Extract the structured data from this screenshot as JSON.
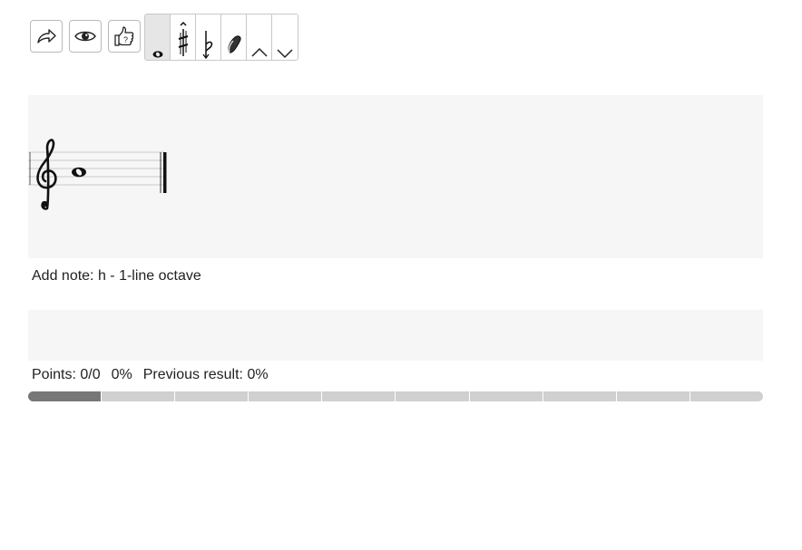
{
  "toolbar": {
    "buttons": [
      {
        "name": "share",
        "icon": "share-arrow-icon"
      },
      {
        "name": "show",
        "icon": "eye-icon"
      },
      {
        "name": "check",
        "icon": "thumbs-up-question-icon"
      }
    ],
    "note_tools": [
      {
        "name": "whole-note",
        "icon": "whole-note-icon",
        "active": true
      },
      {
        "name": "sharp",
        "icon": "sharp-icon"
      },
      {
        "name": "flat",
        "icon": "flat-icon"
      },
      {
        "name": "eraser",
        "icon": "eraser-icon"
      },
      {
        "name": "up",
        "icon": "chevron-up-icon"
      },
      {
        "name": "down",
        "icon": "chevron-down-icon"
      }
    ]
  },
  "staff": {
    "clef": "treble",
    "notes": [
      {
        "pitch": "h",
        "octave": "1-line",
        "duration": "whole"
      }
    ]
  },
  "status_text": "Add note: h - 1-line octave",
  "score": {
    "points": "Points: 0/0",
    "percent": "0%",
    "previous": "Previous result: 0%"
  },
  "progress": {
    "segments_total": 10,
    "segments_done": 1
  },
  "colors": {
    "panel": "#f6f6f6",
    "progress_done": "#777777",
    "progress_todo": "#d0d0d0"
  }
}
